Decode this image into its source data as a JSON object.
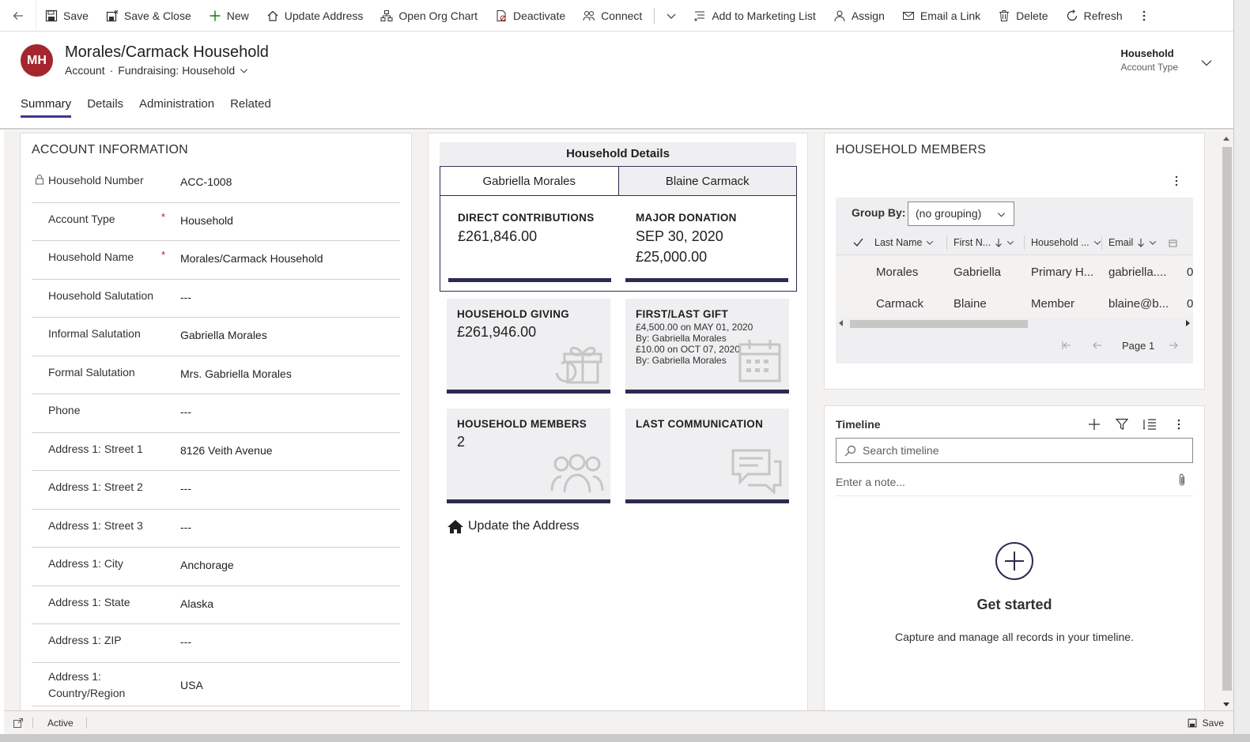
{
  "toolbar": {
    "items": [
      {
        "label": "Save",
        "icon": "save-icon"
      },
      {
        "label": "Save & Close",
        "icon": "save-close-icon"
      },
      {
        "label": "New",
        "icon": "plus-icon"
      },
      {
        "label": "Update Address",
        "icon": "home-icon"
      },
      {
        "label": "Open Org Chart",
        "icon": "org-chart-icon"
      },
      {
        "label": "Deactivate",
        "icon": "deactivate-icon"
      },
      {
        "label": "Connect",
        "icon": "connect-icon"
      },
      {
        "label": "Add to Marketing List",
        "icon": "list-add-icon"
      },
      {
        "label": "Assign",
        "icon": "person-icon"
      },
      {
        "label": "Email a Link",
        "icon": "email-icon"
      },
      {
        "label": "Delete",
        "icon": "trash-icon"
      },
      {
        "label": "Refresh",
        "icon": "refresh-icon"
      }
    ]
  },
  "header": {
    "initials": "MH",
    "avatar_color": "#a4262c",
    "title": "Morales/Carmack Household",
    "entity": "Account",
    "separator": "·",
    "form": "Fundraising: Household",
    "field_value": "Household",
    "field_label": "Account Type"
  },
  "tabs": [
    "Summary",
    "Details",
    "Administration",
    "Related"
  ],
  "account_info": {
    "title": "ACCOUNT INFORMATION",
    "fields": [
      {
        "label": "Household Number",
        "value": "ACC-1008"
      },
      {
        "label": "Account Type",
        "value": "Household",
        "required": "*"
      },
      {
        "label": "Household Name",
        "value": "Morales/Carmack Household",
        "required": "*"
      },
      {
        "label": "Household Salutation",
        "value": "---"
      },
      {
        "label": "Informal Salutation",
        "value": "Gabriella Morales"
      },
      {
        "label": "Formal Salutation",
        "value": "Mrs. Gabriella Morales"
      },
      {
        "label": "Phone",
        "value": "---"
      },
      {
        "label": "Address 1: Street 1",
        "value": "8126 Veith Avenue"
      },
      {
        "label": "Address 1: Street 2",
        "value": "---"
      },
      {
        "label": "Address 1: Street 3",
        "value": "---"
      },
      {
        "label": "Address 1: City",
        "value": "Anchorage"
      },
      {
        "label": "Address 1: State",
        "value": "Alaska"
      },
      {
        "label": "Address 1: ZIP",
        "value": "---"
      },
      {
        "label": "Address 1: Country/Region",
        "value": "USA"
      }
    ]
  },
  "household_details": {
    "title": "Household Details",
    "members": [
      "Gabriella Morales",
      "Blaine Carmack"
    ],
    "direct_contributions_label": "DIRECT CONTRIBUTIONS",
    "direct_contributions_value": "£261,846.00",
    "major_donation_label": "MAJOR DONATION",
    "major_donation_date": "SEP 30, 2020",
    "major_donation_value": "£25,000.00",
    "household_giving_label": "HOUSEHOLD GIVING",
    "household_giving_value": "£261,946.00",
    "first_last_gift_label": "FIRST/LAST GIFT",
    "first_gift": "£4,500.00 on MAY 01, 2020",
    "first_gift_by": "By: Gabriella Morales",
    "last_gift": "£10.00 on OCT 07, 2020",
    "last_gift_by": "By: Gabriella Morales",
    "household_members_label": "HOUSEHOLD MEMBERS",
    "household_members_value": "2",
    "last_communication_label": "LAST COMMUNICATION",
    "update_address": "Update the Address"
  },
  "members_grid": {
    "title": "HOUSEHOLD MEMBERS",
    "group_by_label": "Group By:",
    "group_by_value": "(no grouping)",
    "columns": [
      "Last Name",
      "First N...",
      "Household ...",
      "Email"
    ],
    "rows": [
      {
        "last": "Morales",
        "first": "Gabriella",
        "household": "Primary H...",
        "email": "gabriella....",
        "extra": "0"
      },
      {
        "last": "Carmack",
        "first": "Blaine",
        "household": "Member",
        "email": "blaine@b...",
        "extra": "0"
      }
    ],
    "page": "Page 1"
  },
  "timeline": {
    "title": "Timeline",
    "search_placeholder": "Search timeline",
    "note_placeholder": "Enter a note...",
    "empty_title": "Get started",
    "empty_caption": "Capture and manage all records in your timeline."
  },
  "footer": {
    "status": "Active",
    "save_label": "Save"
  }
}
